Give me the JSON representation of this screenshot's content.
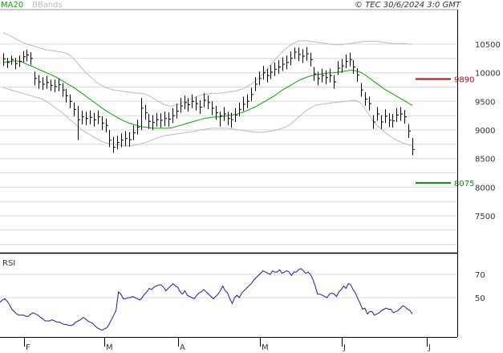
{
  "header": {
    "ma_legend": "MA20",
    "bb_legend": "BBands",
    "copyright": "© TEC 30/6/2024 3:0 GMT"
  },
  "chart_data": [
    {
      "type": "ohlc",
      "y_ticks": [
        "10500",
        "10000",
        "9500",
        "9000",
        "8500",
        "8000",
        "7500"
      ],
      "y_tick_values": [
        10500,
        10000,
        9500,
        9000,
        8500,
        8000,
        7500
      ],
      "ylim": [
        7000,
        10750
      ],
      "grid": true,
      "x_labels": [
        "F",
        "M",
        "A",
        "M",
        "J",
        "J"
      ],
      "series": [
        {
          "name": "MA20",
          "color": "#00aa00"
        },
        {
          "name": "BBands",
          "color": "#bbbbbb"
        }
      ],
      "close": [
        10240,
        10180,
        10230,
        10160,
        10200,
        10280,
        10310,
        10250,
        9900,
        9840,
        9800,
        9830,
        9780,
        9760,
        9790,
        9700,
        9600,
        9500,
        9360,
        9180,
        9230,
        9200,
        9220,
        9180,
        9230,
        9120,
        9080,
        8820,
        8700,
        8780,
        8820,
        8850,
        8830,
        8950,
        9050,
        9380,
        9300,
        9150,
        9130,
        9180,
        9170,
        9200,
        9190,
        9250,
        9330,
        9420,
        9480,
        9440,
        9500,
        9460,
        9400,
        9520,
        9480,
        9380,
        9300,
        9250,
        9280,
        9200,
        9180,
        9260,
        9360,
        9450,
        9500,
        9620,
        9800,
        9900,
        10000,
        9950,
        10010,
        10060,
        10100,
        10150,
        10180,
        10250,
        10360,
        10320,
        10290,
        10330,
        10230,
        9980,
        9900,
        9950,
        9920,
        9950,
        9840,
        10080,
        10120,
        10200,
        10230,
        10100,
        9960,
        9700,
        9540,
        9460,
        9140,
        9280,
        9140,
        9240,
        9170,
        9160,
        9260,
        9280,
        9230,
        8980,
        8660
      ],
      "ranges": [
        [
          10120,
          10340
        ],
        [
          10080,
          10260
        ],
        [
          10140,
          10300
        ],
        [
          10060,
          10260
        ],
        [
          10100,
          10300
        ],
        [
          10180,
          10380
        ],
        [
          10200,
          10400
        ],
        [
          10140,
          10360
        ],
        [
          9780,
          10020
        ],
        [
          9720,
          9960
        ],
        [
          9700,
          9920
        ],
        [
          9720,
          9940
        ],
        [
          9680,
          9880
        ],
        [
          9660,
          9880
        ],
        [
          9680,
          9900
        ],
        [
          9580,
          9820
        ],
        [
          9480,
          9720
        ],
        [
          9380,
          9620
        ],
        [
          9240,
          9480
        ],
        [
          8820,
          9420
        ],
        [
          9100,
          9340
        ],
        [
          9080,
          9320
        ],
        [
          9100,
          9340
        ],
        [
          9060,
          9300
        ],
        [
          9100,
          9340
        ],
        [
          9000,
          9240
        ],
        [
          8960,
          9200
        ],
        [
          8700,
          9000
        ],
        [
          8600,
          8880
        ],
        [
          8660,
          8900
        ],
        [
          8700,
          8940
        ],
        [
          8720,
          8980
        ],
        [
          8710,
          8960
        ],
        [
          8820,
          9080
        ],
        [
          8920,
          9180
        ],
        [
          9000,
          9560
        ],
        [
          9180,
          9440
        ],
        [
          9020,
          9280
        ],
        [
          9000,
          9260
        ],
        [
          9060,
          9300
        ],
        [
          9040,
          9290
        ],
        [
          9070,
          9320
        ],
        [
          9060,
          9310
        ],
        [
          9120,
          9380
        ],
        [
          9200,
          9460
        ],
        [
          9300,
          9560
        ],
        [
          9360,
          9600
        ],
        [
          9320,
          9560
        ],
        [
          9380,
          9620
        ],
        [
          9340,
          9580
        ],
        [
          9280,
          9520
        ],
        [
          9400,
          9640
        ],
        [
          9360,
          9600
        ],
        [
          9260,
          9500
        ],
        [
          9180,
          9420
        ],
        [
          9060,
          9320
        ],
        [
          9160,
          9400
        ],
        [
          9080,
          9320
        ],
        [
          9040,
          9300
        ],
        [
          9140,
          9380
        ],
        [
          9240,
          9480
        ],
        [
          9330,
          9580
        ],
        [
          9380,
          9620
        ],
        [
          9500,
          9740
        ],
        [
          9680,
          9920
        ],
        [
          9780,
          10020
        ],
        [
          9880,
          10120
        ],
        [
          9830,
          10070
        ],
        [
          9890,
          10130
        ],
        [
          9940,
          10180
        ],
        [
          9980,
          10220
        ],
        [
          10030,
          10270
        ],
        [
          10060,
          10300
        ],
        [
          10130,
          10370
        ],
        [
          10240,
          10440
        ],
        [
          10200,
          10440
        ],
        [
          10170,
          10410
        ],
        [
          10210,
          10450
        ],
        [
          10110,
          10350
        ],
        [
          9860,
          10100
        ],
        [
          9780,
          10020
        ],
        [
          9830,
          10070
        ],
        [
          9800,
          10040
        ],
        [
          9830,
          10070
        ],
        [
          9720,
          9960
        ],
        [
          9960,
          10200
        ],
        [
          10000,
          10240
        ],
        [
          10080,
          10320
        ],
        [
          10110,
          10350
        ],
        [
          9980,
          10220
        ],
        [
          9840,
          10080
        ],
        [
          9580,
          9820
        ],
        [
          9420,
          9660
        ],
        [
          9340,
          9580
        ],
        [
          9020,
          9260
        ],
        [
          9160,
          9400
        ],
        [
          9020,
          9260
        ],
        [
          9120,
          9360
        ],
        [
          9050,
          9290
        ],
        [
          9040,
          9280
        ],
        [
          9140,
          9380
        ],
        [
          9160,
          9400
        ],
        [
          9110,
          9350
        ],
        [
          8860,
          9100
        ],
        [
          8560,
          8860
        ]
      ],
      "ma20": [
        10180,
        10190,
        10200,
        10210,
        10200,
        10180,
        10150,
        10120,
        10090,
        10060,
        10030,
        10000,
        9970,
        9940,
        9900,
        9860,
        9820,
        9780,
        9740,
        9690,
        9640,
        9590,
        9540,
        9490,
        9440,
        9390,
        9340,
        9300,
        9260,
        9220,
        9180,
        9150,
        9120,
        9100,
        9080,
        9060,
        9050,
        9040,
        9030,
        9030,
        9030,
        9030,
        9030,
        9040,
        9060,
        9080,
        9100,
        9120,
        9140,
        9160,
        9180,
        9200,
        9210,
        9220,
        9230,
        9230,
        9240,
        9250,
        9260,
        9270,
        9290,
        9310,
        9340,
        9370,
        9400,
        9440,
        9480,
        9520,
        9560,
        9600,
        9650,
        9700,
        9740,
        9780,
        9820,
        9860,
        9890,
        9920,
        9940,
        9960,
        9970,
        9980,
        9990,
        10000,
        10000,
        10010,
        10020,
        10030,
        10040,
        10040,
        10030,
        10000,
        9960,
        9910,
        9860,
        9810,
        9760,
        9710,
        9670,
        9630,
        9590,
        9550,
        9510,
        9470,
        9430
      ],
      "bb_upper": [
        10700,
        10670,
        10640,
        10600,
        10560,
        10530,
        10500,
        10480,
        10460,
        10440,
        10420,
        10400,
        10390,
        10380,
        10370,
        10360,
        10340,
        10300,
        10240,
        10160,
        10080,
        10000,
        9940,
        9880,
        9820,
        9780,
        9740,
        9720,
        9700,
        9690,
        9680,
        9670,
        9660,
        9650,
        9640,
        9640,
        9630,
        9600,
        9560,
        9520,
        9480,
        9440,
        9420,
        9420,
        9440,
        9460,
        9490,
        9520,
        9550,
        9580,
        9600,
        9620,
        9630,
        9640,
        9640,
        9640,
        9650,
        9660,
        9670,
        9680,
        9700,
        9720,
        9760,
        9800,
        9850,
        9910,
        9980,
        10060,
        10140,
        10220,
        10300,
        10370,
        10430,
        10480,
        10520,
        10550,
        10560,
        10560,
        10550,
        10540,
        10530,
        10520,
        10510,
        10500,
        10490,
        10490,
        10490,
        10500,
        10510,
        10520,
        10530,
        10540,
        10550,
        10550,
        10550,
        10550,
        10540,
        10530,
        10520,
        10510,
        10510,
        10510,
        10510,
        10500,
        10500
      ],
      "bb_lower": [
        9740,
        9720,
        9700,
        9680,
        9660,
        9640,
        9620,
        9600,
        9580,
        9560,
        9540,
        9500,
        9450,
        9400,
        9350,
        9300,
        9240,
        9180,
        9120,
        9060,
        9000,
        8960,
        8920,
        8880,
        8840,
        8800,
        8780,
        8760,
        8750,
        8740,
        8730,
        8720,
        8720,
        8730,
        8740,
        8760,
        8780,
        8800,
        8830,
        8860,
        8880,
        8900,
        8910,
        8920,
        8930,
        8940,
        8950,
        8960,
        8970,
        8980,
        9000,
        9010,
        9020,
        9030,
        9030,
        9030,
        9030,
        9030,
        9020,
        9010,
        9000,
        8990,
        8980,
        8970,
        8960,
        8960,
        8960,
        8970,
        8980,
        8990,
        9010,
        9030,
        9060,
        9100,
        9160,
        9220,
        9280,
        9340,
        9380,
        9420,
        9440,
        9450,
        9460,
        9470,
        9480,
        9480,
        9490,
        9500,
        9510,
        9520,
        9510,
        9460,
        9370,
        9260,
        9160,
        9080,
        9020,
        8960,
        8910,
        8860,
        8820,
        8790,
        8760,
        8740,
        8720
      ],
      "levels": [
        {
          "label": "9890",
          "value": 9890,
          "color": "#cc0000"
        },
        {
          "label": "8075",
          "value": 8075,
          "color": "#009900"
        }
      ]
    },
    {
      "type": "line",
      "title": "RSI",
      "y_ticks": [
        "70",
        "50"
      ],
      "y_tick_values": [
        70,
        50
      ],
      "ylim": [
        15,
        85
      ],
      "grid": true,
      "x_labels": [
        "F",
        "M",
        "A",
        "M",
        "J",
        "J"
      ],
      "series": [
        {
          "name": "RSI",
          "color": "#1a1aaa",
          "values": [
            46,
            48,
            49,
            47,
            44,
            40,
            38,
            36,
            35,
            35,
            35,
            34,
            34,
            36,
            37,
            36,
            35,
            33,
            32,
            30,
            30,
            30,
            31,
            30,
            29,
            29,
            28,
            27,
            27,
            26,
            26,
            27,
            29,
            30,
            31,
            33,
            32,
            30,
            29,
            28,
            26,
            24,
            23,
            22,
            23,
            24,
            27,
            31,
            35,
            39,
            55,
            53,
            49,
            49,
            50,
            50,
            51,
            50,
            49,
            48,
            50,
            53,
            55,
            58,
            57,
            59,
            60,
            61,
            61,
            59,
            56,
            58,
            60,
            62,
            60,
            59,
            55,
            53,
            56,
            52,
            51,
            50,
            49,
            52,
            54,
            55,
            57,
            55,
            53,
            51,
            49,
            51,
            53,
            56,
            60,
            56,
            54,
            49,
            45,
            50,
            52,
            50,
            54,
            56,
            58,
            60,
            62,
            65,
            67,
            69,
            71,
            73,
            72,
            71,
            70,
            73,
            72,
            72,
            74,
            71,
            72,
            73,
            72,
            69,
            72,
            72,
            74,
            75,
            73,
            71,
            72,
            70,
            66,
            60,
            53,
            53,
            52,
            51,
            50,
            53,
            54,
            53,
            51,
            55,
            57,
            60,
            58,
            62,
            61,
            57,
            54,
            49,
            45,
            40,
            41,
            36,
            38,
            38,
            35,
            36,
            37,
            39,
            40,
            41,
            40,
            40,
            37,
            38,
            39,
            41,
            43,
            42,
            40,
            39,
            36
          ]
        }
      ]
    }
  ]
}
